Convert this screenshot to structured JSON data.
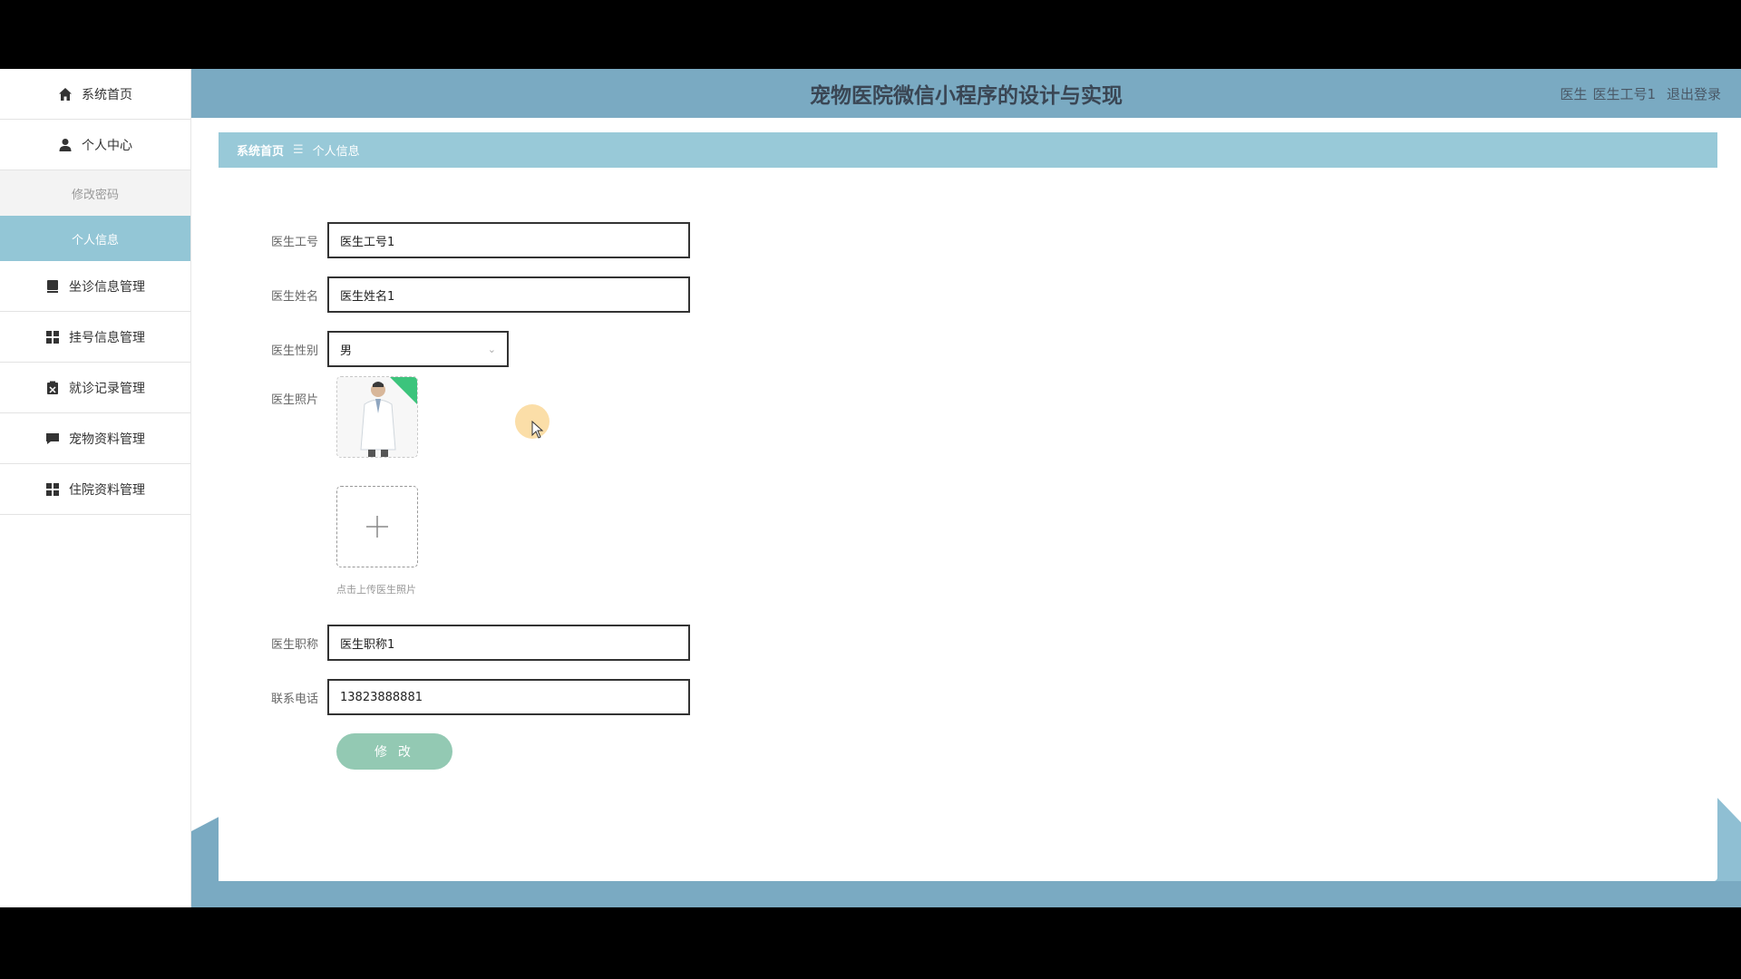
{
  "sidebar": {
    "items": [
      {
        "label": "系统首页",
        "icon": "home-icon"
      },
      {
        "label": "个人中心",
        "icon": "user-icon"
      }
    ],
    "sub_items": [
      {
        "label": "修改密码",
        "active": false
      },
      {
        "label": "个人信息",
        "active": true
      }
    ],
    "more_items": [
      {
        "label": "坐诊信息管理",
        "icon": "calendar-icon"
      },
      {
        "label": "挂号信息管理",
        "icon": "grid-icon"
      },
      {
        "label": "就诊记录管理",
        "icon": "clipboard-icon"
      },
      {
        "label": "宠物资料管理",
        "icon": "chat-icon"
      },
      {
        "label": "住院资料管理",
        "icon": "grid-icon"
      }
    ]
  },
  "header": {
    "title": "宠物医院微信小程序的设计与实现",
    "role": "医生",
    "username": "医生工号1",
    "logout_label": "退出登录"
  },
  "breadcrumb": {
    "home": "系统首页",
    "separator": "☰",
    "current": "个人信息"
  },
  "form": {
    "doctor_id": {
      "label": "医生工号",
      "value": "医生工号1"
    },
    "doctor_name": {
      "label": "医生姓名",
      "value": "医生姓名1"
    },
    "gender": {
      "label": "医生性别",
      "value": "男"
    },
    "photo": {
      "label": "医生照片",
      "upload_hint": "点击上传医生照片"
    },
    "title": {
      "label": "医生职称",
      "value": "医生职称1"
    },
    "phone": {
      "label": "联系电话",
      "value": "13823888881"
    },
    "submit_label": "修 改"
  },
  "colors": {
    "header_bg": "#7aaac2",
    "breadcrumb_bg": "#98c9d8",
    "active_menu_bg": "#93c6d6",
    "button_bg": "#93c9b3"
  }
}
